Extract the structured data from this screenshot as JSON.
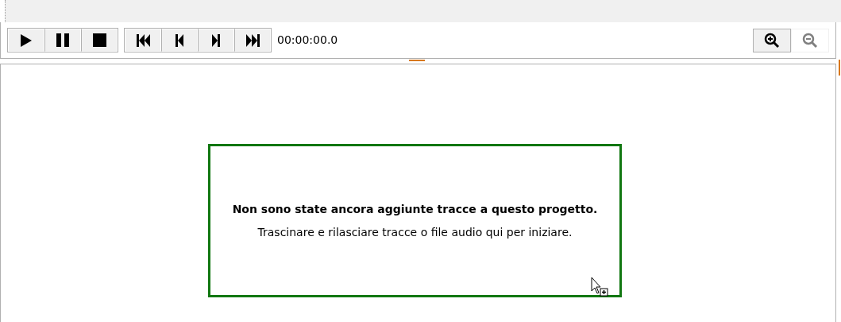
{
  "transport_groups": [
    {
      "buttons": [
        {
          "kind": "play"
        },
        {
          "kind": "pause"
        },
        {
          "kind": "stop"
        }
      ]
    },
    {
      "buttons": [
        {
          "kind": "first"
        },
        {
          "kind": "previous"
        },
        {
          "kind": "next"
        },
        {
          "kind": "last"
        }
      ]
    }
  ],
  "time": "00:00:00.0",
  "zoom_buttons": [
    {
      "kind": "zoom-in",
      "disabled": false
    },
    {
      "kind": "zoom-out",
      "disabled": true
    }
  ],
  "drop_zone": {
    "title": "Non sono state ancora aggiunte tracce a questo progetto.",
    "hint": "Trascinare e rilasciare tracce o file audio qui per iniziare."
  }
}
